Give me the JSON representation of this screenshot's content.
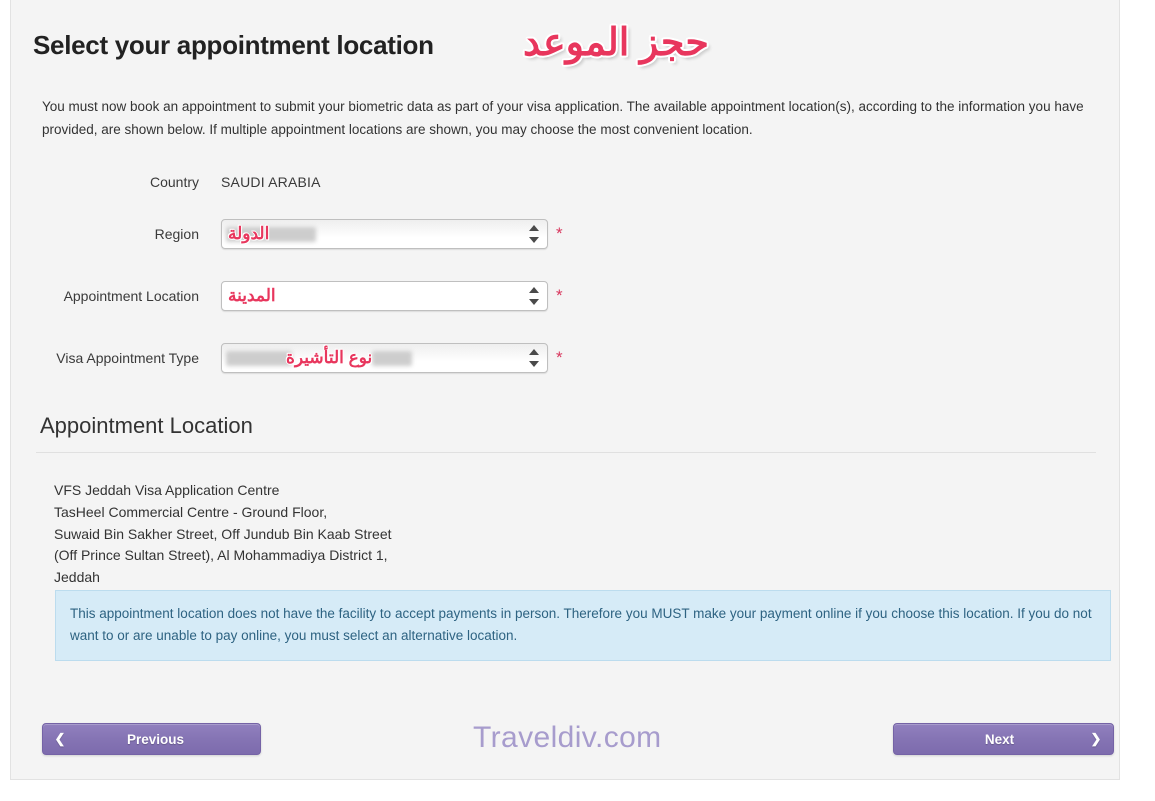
{
  "page": {
    "title": "Select your appointment location",
    "arabic_title": "حجز الموعد",
    "intro": "You must now book an appointment to submit your biometric data as part of your visa application. The available appointment location(s), according to the information you have provided, are shown below. If multiple appointment locations are shown, you may choose the most convenient location."
  },
  "form": {
    "country": {
      "label": "Country",
      "value": "SAUDI ARABIA"
    },
    "region": {
      "label": "Region",
      "arabic_overlay": "الدولة",
      "required_marker": "*"
    },
    "appointment_location": {
      "label": "Appointment Location",
      "arabic_overlay": "المدينة",
      "required_marker": "*"
    },
    "visa_appointment_type": {
      "label": "Visa Appointment Type",
      "arabic_overlay": "نوع التأشيرة",
      "required_marker": "*"
    }
  },
  "section": {
    "heading": "Appointment Location",
    "address": {
      "line1": "VFS Jeddah Visa Application Centre",
      "line2": "TasHeel Commercial Centre - Ground Floor,",
      "line3": "Suwaid Bin Sakher Street, Off Jundub Bin Kaab Street",
      "line4": "(Off Prince Sultan Street), Al Mohammadiya District 1,",
      "line5": "Jeddah"
    },
    "notice": "This appointment location does not have the facility to accept payments in person. Therefore you MUST make your payment online if you choose this location. If you do not want to or are unable to pay online, you must select an alternative location."
  },
  "footer": {
    "previous_label": "Previous",
    "previous_chevron": "❮",
    "next_label": "Next",
    "next_chevron": "❯",
    "watermark": "Traveldiv.com"
  },
  "colors": {
    "accent_pink": "#e8365d",
    "button_purple": "#8574b4",
    "notice_bg": "#d6ebf7",
    "notice_text": "#2e6382",
    "watermark": "#a79ccd"
  }
}
